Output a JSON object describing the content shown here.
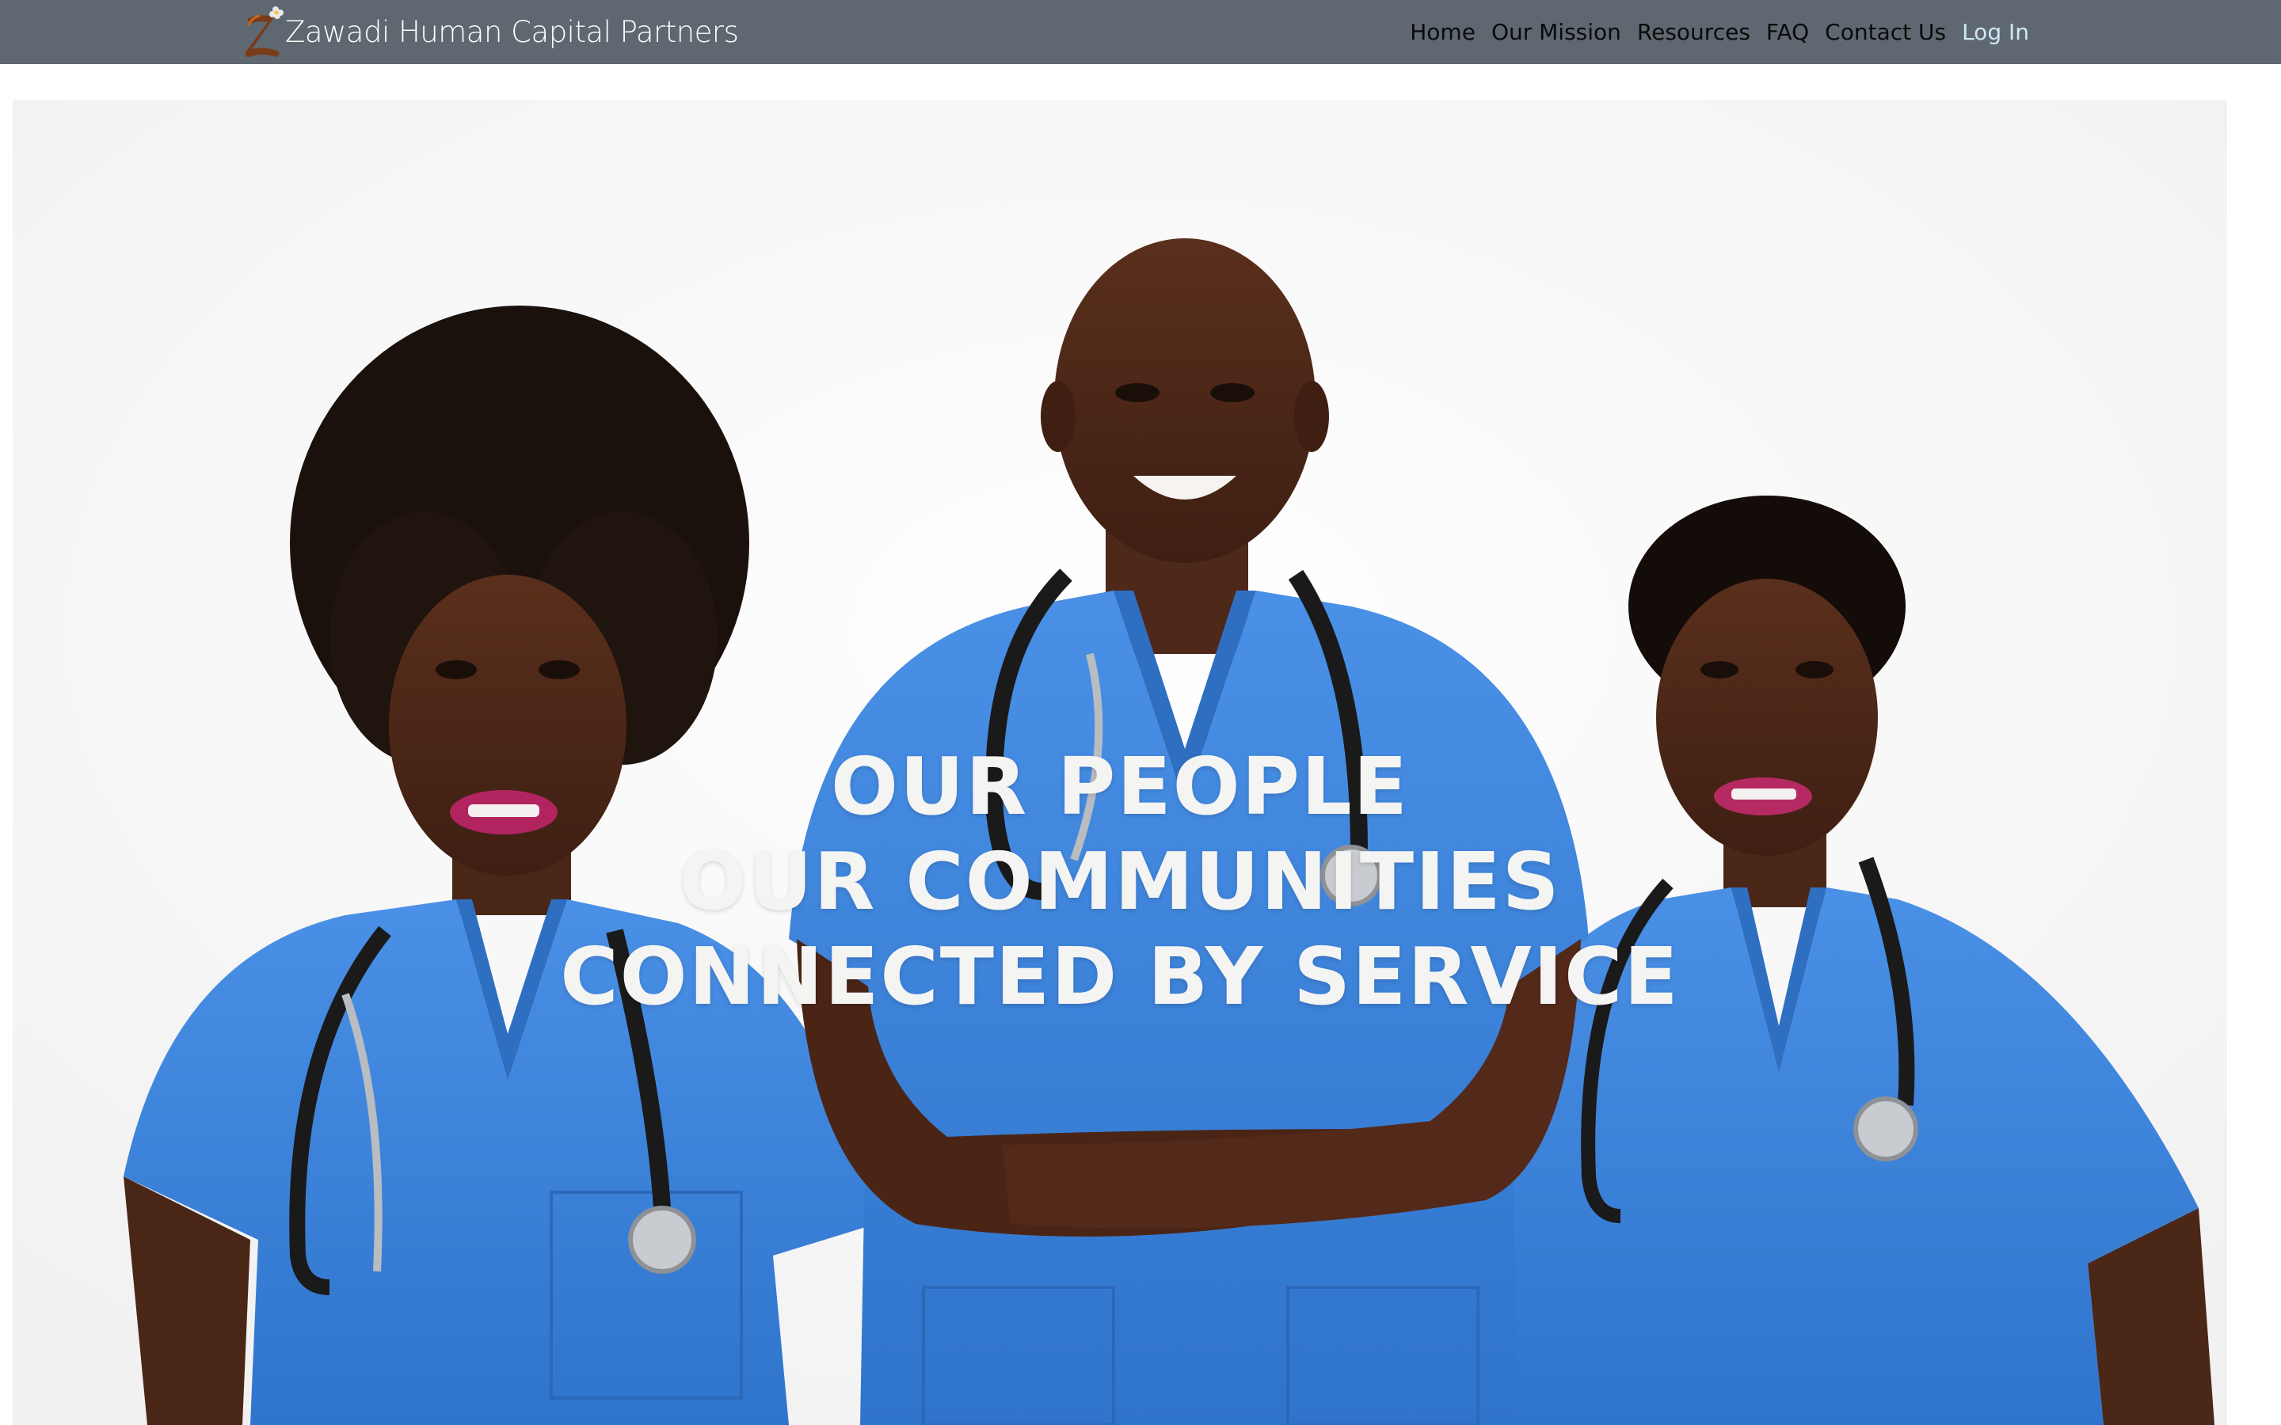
{
  "header": {
    "brand_name": "Zawadi Human Capital Partners",
    "logo_icon": "zawadi-z-logo-icon",
    "nav": [
      {
        "label": "Home"
      },
      {
        "label": "Our Mission"
      },
      {
        "label": "Resources"
      },
      {
        "label": "FAQ"
      },
      {
        "label": "Contact Us"
      },
      {
        "label": "Log In"
      }
    ]
  },
  "hero": {
    "image": "photo of three healthcare workers in blue scrubs with stethoscopes",
    "lines": [
      "OUR PEOPLE",
      "OUR COMMUNITIES",
      "CONNECTED BY SERVICE"
    ]
  },
  "colors": {
    "navbar_bg": "#5f6870",
    "nav_text": "#0a0a0a",
    "login_text": "#cfe6f5",
    "scrubs_blue": "#3f86dc",
    "hero_text": "#f4f4f2"
  }
}
